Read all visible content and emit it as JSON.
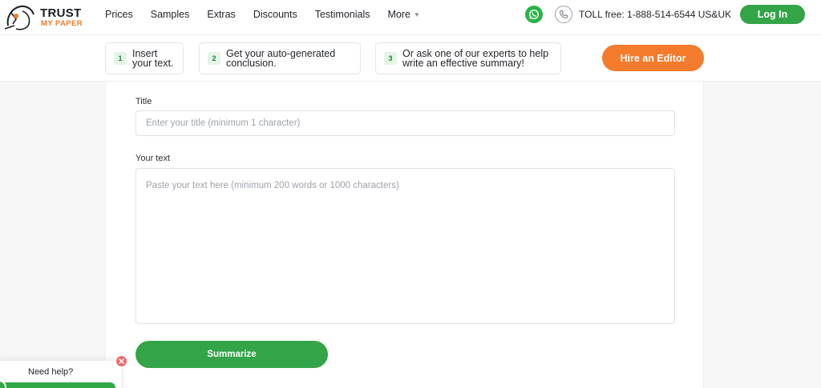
{
  "header": {
    "logo": {
      "line1": "TRUST",
      "line2": "MY PAPER"
    },
    "nav": [
      {
        "label": "Prices"
      },
      {
        "label": "Samples"
      },
      {
        "label": "Extras"
      },
      {
        "label": "Discounts"
      },
      {
        "label": "Testimonials"
      },
      {
        "label": "More"
      }
    ],
    "tollfree": "TOLL free: 1-888-514-6544 US&UK",
    "login_label": "Log In"
  },
  "steps": [
    {
      "num": "1",
      "line1": "Insert",
      "line2": "your text."
    },
    {
      "num": "2",
      "line1": "Get your auto-generated",
      "line2": "conclusion."
    },
    {
      "num": "3",
      "line1": "Or ask one of our experts to help",
      "line2": "write an effective summary!"
    }
  ],
  "hire_label": "Hire an Editor",
  "form": {
    "title_label": "Title",
    "title_placeholder": "Enter your title (minimum 1 character)",
    "text_label": "Your text",
    "text_placeholder": "Paste your text here (minimum 200 words or 1000 characters)",
    "submit_label": "Summarize"
  },
  "help": {
    "label": "Need help?"
  },
  "colors": {
    "brand_green": "#33a447",
    "brand_orange": "#f47a2c",
    "close_red": "#f06b6b"
  },
  "icons": {
    "whatsapp": "whatsapp-icon",
    "phone": "phone-icon",
    "caret": "chevron-down-icon",
    "close": "close-icon"
  }
}
